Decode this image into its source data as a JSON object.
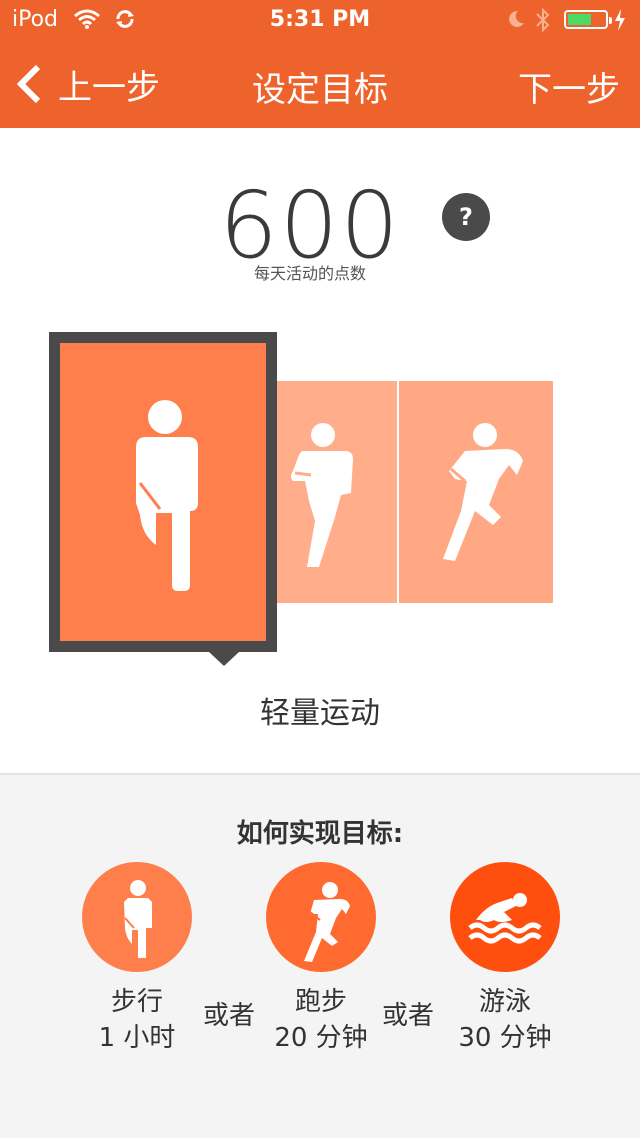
{
  "status_bar": {
    "carrier": "iPod",
    "time": "5:31 PM",
    "battery_level": 0.65
  },
  "nav": {
    "back_label": "上一步",
    "title": "设定目标",
    "next_label": "下一步"
  },
  "goal": {
    "points": "600",
    "caption": "每天活动的点数",
    "help_label": "?"
  },
  "levels": {
    "selected_label": "轻量运动",
    "selected_index": 0,
    "count": 3
  },
  "howto": {
    "title": "如何实现目标:",
    "options": [
      {
        "activity": "步行",
        "duration": "1 小时",
        "icon": "walking-icon"
      },
      {
        "activity": "跑步",
        "duration": "20 分钟",
        "icon": "running-icon"
      },
      {
        "activity": "游泳",
        "duration": "30 分钟",
        "icon": "swimming-icon"
      }
    ],
    "or_label": "或者"
  },
  "colors": {
    "header": "#ee622c",
    "level_selected": "#ff7f4c",
    "level_medium": "#ffad8a",
    "level_high": "#ffa883",
    "selection_frame": "#4a4a4a",
    "walk_circle": "#ff7f4c",
    "run_circle": "#ff6a31",
    "swim_circle": "#ff4f0f",
    "section_bg": "#f4f4f4"
  }
}
